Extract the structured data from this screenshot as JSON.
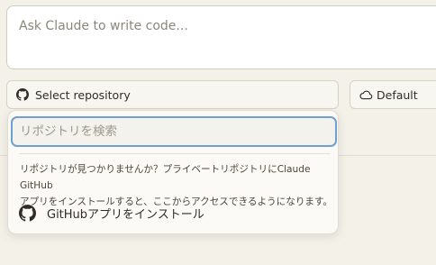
{
  "prompt": {
    "placeholder": "Ask Claude to write code..."
  },
  "repo_select": {
    "label": "Select repository",
    "icon": "github-icon"
  },
  "env_select": {
    "label": "Default",
    "icon": "cloud-icon"
  },
  "dropdown": {
    "search_placeholder": "リポジトリを検索",
    "help_line1": "リポジトリが見つかりませんか？プライベートリポジトリにClaude GitHub",
    "help_line2": "アプリをインストールすると、ここからアクセスできるようになります。",
    "install_label": "GitHubアプリをインストール",
    "install_icon": "github-icon"
  },
  "colors": {
    "focus_ring": "#6f9fd4",
    "background": "#f4f1e9"
  }
}
